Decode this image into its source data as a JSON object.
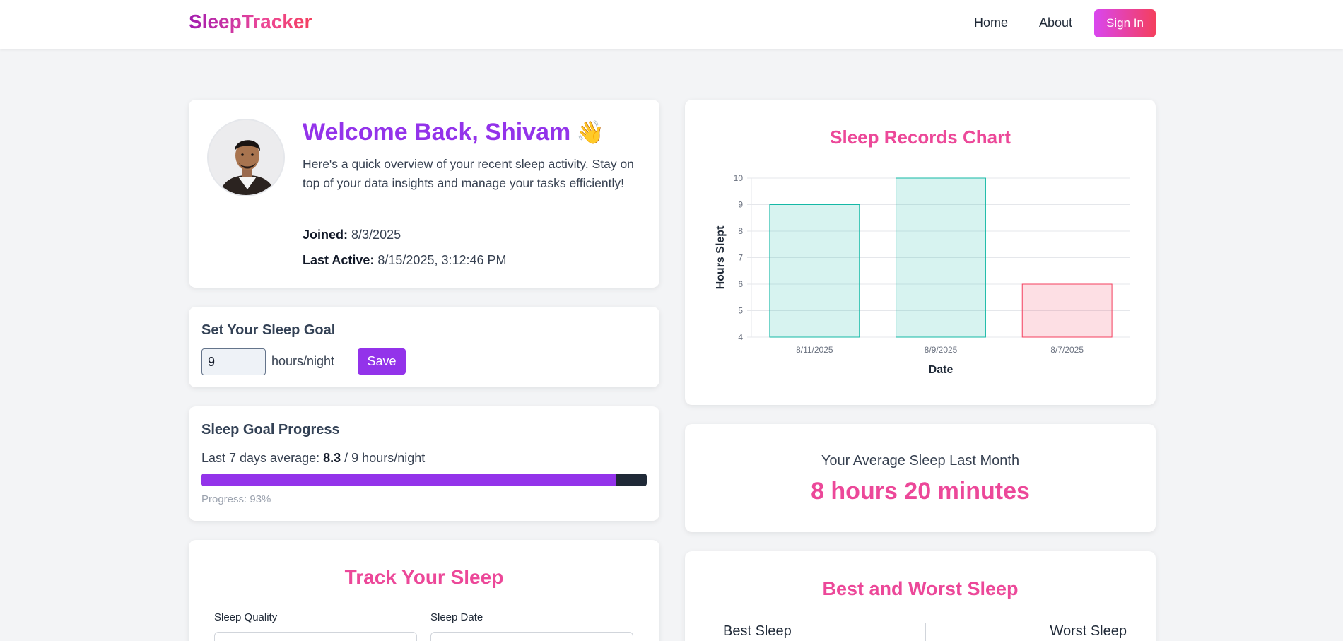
{
  "nav": {
    "logo": "SleepTracker",
    "home": "Home",
    "about": "About",
    "sign_in": "Sign In"
  },
  "welcome": {
    "title": "Welcome Back, Shivam",
    "wave_emoji": "👋",
    "description": "Here's a quick overview of your recent sleep activity. Stay on top of your data insights and manage your tasks efficiently!",
    "joined_label": "Joined:",
    "joined_value": "8/3/2025",
    "last_active_label": "Last Active:",
    "last_active_value": "8/15/2025, 3:12:46 PM"
  },
  "goal": {
    "heading": "Set Your Sleep Goal",
    "input_value": "9",
    "unit": "hours/night",
    "save_label": "Save"
  },
  "progress": {
    "heading": "Sleep Goal Progress",
    "line_prefix": "Last 7 days average:",
    "average": "8.3",
    "line_suffix": "/ 9 hours/night",
    "percent": 93,
    "progress_text": "Progress: 93%"
  },
  "track": {
    "title": "Track Your Sleep",
    "quality_label": "Sleep Quality",
    "date_label": "Sleep Date"
  },
  "chart_data": {
    "type": "bar",
    "title": "Sleep Records Chart",
    "xlabel": "Date",
    "ylabel": "Hours Slept",
    "categories": [
      "8/11/2025",
      "8/9/2025",
      "8/7/2025"
    ],
    "values": [
      9,
      10,
      6
    ],
    "colors": [
      "#14b8a6",
      "#14b8a6",
      "#f43f5e"
    ],
    "ylim": [
      4,
      10
    ],
    "yticks": [
      4,
      5,
      6,
      7,
      8,
      9,
      10
    ],
    "grid": true
  },
  "average": {
    "label": "Your Average Sleep Last Month",
    "value": "8 hours 20 minutes"
  },
  "best_worst": {
    "title": "Best and Worst Sleep",
    "best_label": "Best Sleep",
    "worst_label": "Worst Sleep"
  }
}
